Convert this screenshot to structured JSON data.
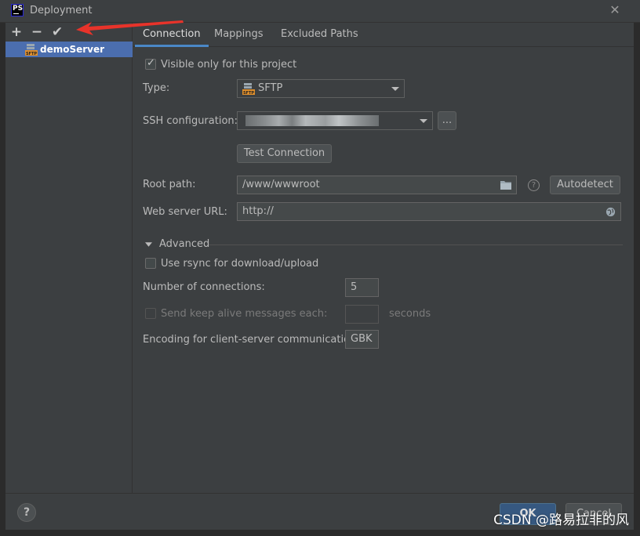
{
  "window": {
    "app_icon_label": "PS",
    "title": "Deployment",
    "close_glyph": "✕"
  },
  "toolbar": {
    "add_glyph": "+",
    "remove_glyph": "−",
    "apply_glyph": "✔"
  },
  "servers": [
    {
      "name": "demoServer",
      "icon": "sftp-server-icon"
    }
  ],
  "tabs": [
    {
      "label": "Connection",
      "active": true
    },
    {
      "label": "Mappings",
      "active": false
    },
    {
      "label": "Excluded Paths",
      "active": false
    }
  ],
  "connection": {
    "visible_only_label": "Visible only for this project",
    "visible_only_checked": true,
    "type_label": "Type:",
    "type_value": "SFTP",
    "ssh_label": "SSH configuration:",
    "ssh_more_glyph": "...",
    "test_connection_label": "Test Connection",
    "root_path_label": "Root path:",
    "root_path_value": "/www/wwwroot",
    "autodetect_label": "Autodetect",
    "help_glyph": "?",
    "web_url_label": "Web server URL:",
    "web_url_value": "http://"
  },
  "advanced": {
    "section_label": "Advanced",
    "rsync_label": "Use rsync for download/upload",
    "rsync_checked": false,
    "connections_label": "Number of connections:",
    "connections_value": "5",
    "keepalive_label": "Send keep alive messages each:",
    "keepalive_value": "",
    "keepalive_unit": "seconds",
    "encoding_label": "Encoding for client-server communication:",
    "encoding_value": "GBK"
  },
  "footer": {
    "help_glyph": "?",
    "ok_label": "OK",
    "cancel_label": "Cancel"
  },
  "watermark": "CSDN @路易拉非的风",
  "colors": {
    "accent": "#4a88c7",
    "selection": "#4b6eaf",
    "annotation_arrow": "#e8332a"
  }
}
